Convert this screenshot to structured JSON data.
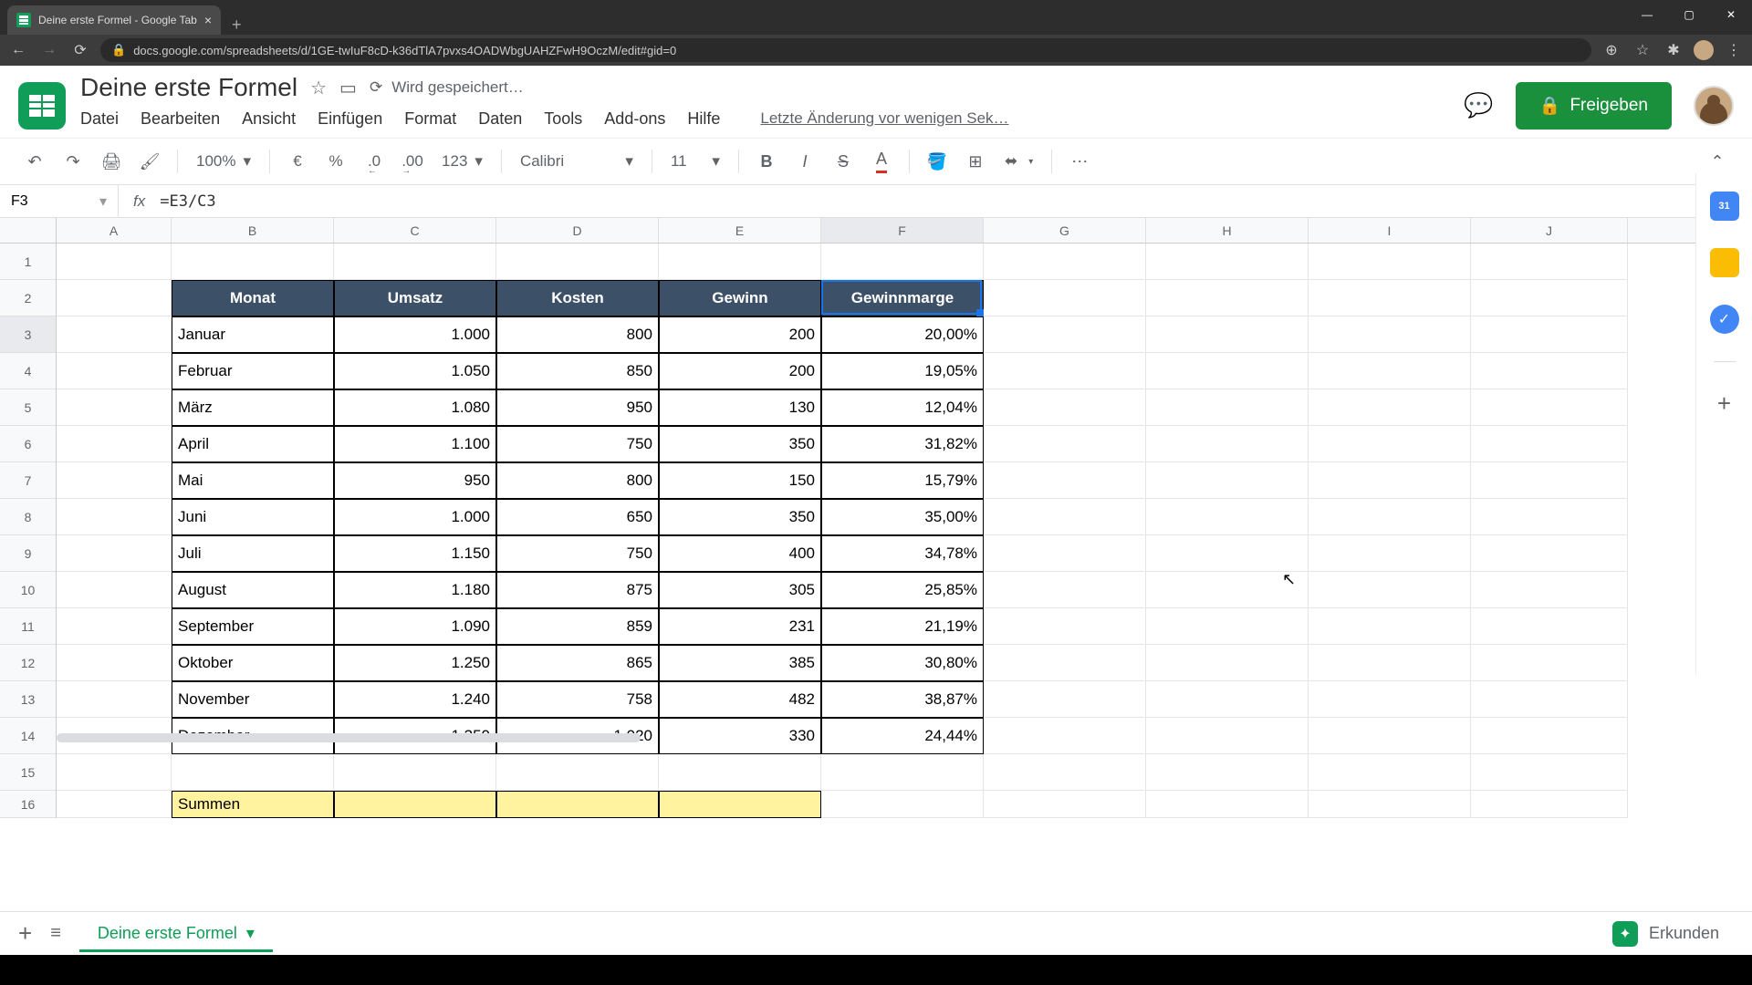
{
  "browser": {
    "tab_title": "Deine erste Formel - Google Tab",
    "url": "docs.google.com/spreadsheets/d/1GE-twIuF8cD-k36dTlA7pvxs4OADWbgUAHZFwH9OczM/edit#gid=0"
  },
  "doc": {
    "title": "Deine erste Formel",
    "save_status": "Wird gespeichert…",
    "last_edit": "Letzte Änderung vor wenigen Sek…",
    "share_label": "Freigeben"
  },
  "menu": {
    "file": "Datei",
    "edit": "Bearbeiten",
    "view": "Ansicht",
    "insert": "Einfügen",
    "format": "Format",
    "data": "Daten",
    "tools": "Tools",
    "addons": "Add-ons",
    "help": "Hilfe"
  },
  "toolbar": {
    "zoom": "100%",
    "currency": "€",
    "percent": "%",
    "dec_less": ".0",
    "dec_more": ".00",
    "num_fmt": "123",
    "font": "Calibri",
    "size": "11"
  },
  "formula": {
    "cell_ref": "F3",
    "expr": "=E3/C3"
  },
  "columns": [
    "A",
    "B",
    "C",
    "D",
    "E",
    "F",
    "G",
    "H",
    "I",
    "J"
  ],
  "row_count": 16,
  "selection": {
    "col": "F",
    "row": 3
  },
  "table": {
    "headers": {
      "monat": "Monat",
      "umsatz": "Umsatz",
      "kosten": "Kosten",
      "gewinn": "Gewinn",
      "marge": "Gewinnmarge"
    },
    "rows": [
      {
        "monat": "Januar",
        "umsatz": "1.000",
        "kosten": "800",
        "gewinn": "200",
        "marge": "20,00%"
      },
      {
        "monat": "Februar",
        "umsatz": "1.050",
        "kosten": "850",
        "gewinn": "200",
        "marge": "19,05%"
      },
      {
        "monat": "März",
        "umsatz": "1.080",
        "kosten": "950",
        "gewinn": "130",
        "marge": "12,04%"
      },
      {
        "monat": "April",
        "umsatz": "1.100",
        "kosten": "750",
        "gewinn": "350",
        "marge": "31,82%"
      },
      {
        "monat": "Mai",
        "umsatz": "950",
        "kosten": "800",
        "gewinn": "150",
        "marge": "15,79%"
      },
      {
        "monat": "Juni",
        "umsatz": "1.000",
        "kosten": "650",
        "gewinn": "350",
        "marge": "35,00%"
      },
      {
        "monat": "Juli",
        "umsatz": "1.150",
        "kosten": "750",
        "gewinn": "400",
        "marge": "34,78%"
      },
      {
        "monat": "August",
        "umsatz": "1.180",
        "kosten": "875",
        "gewinn": "305",
        "marge": "25,85%"
      },
      {
        "monat": "September",
        "umsatz": "1.090",
        "kosten": "859",
        "gewinn": "231",
        "marge": "21,19%"
      },
      {
        "monat": "Oktober",
        "umsatz": "1.250",
        "kosten": "865",
        "gewinn": "385",
        "marge": "30,80%"
      },
      {
        "monat": "November",
        "umsatz": "1.240",
        "kosten": "758",
        "gewinn": "482",
        "marge": "38,87%"
      },
      {
        "monat": "Dezember",
        "umsatz": "1.350",
        "kosten": "1.020",
        "gewinn": "330",
        "marge": "24,44%"
      }
    ],
    "summary_label": "Summen"
  },
  "sheet_tabs": {
    "active": "Deine erste Formel"
  },
  "explore": "Erkunden"
}
